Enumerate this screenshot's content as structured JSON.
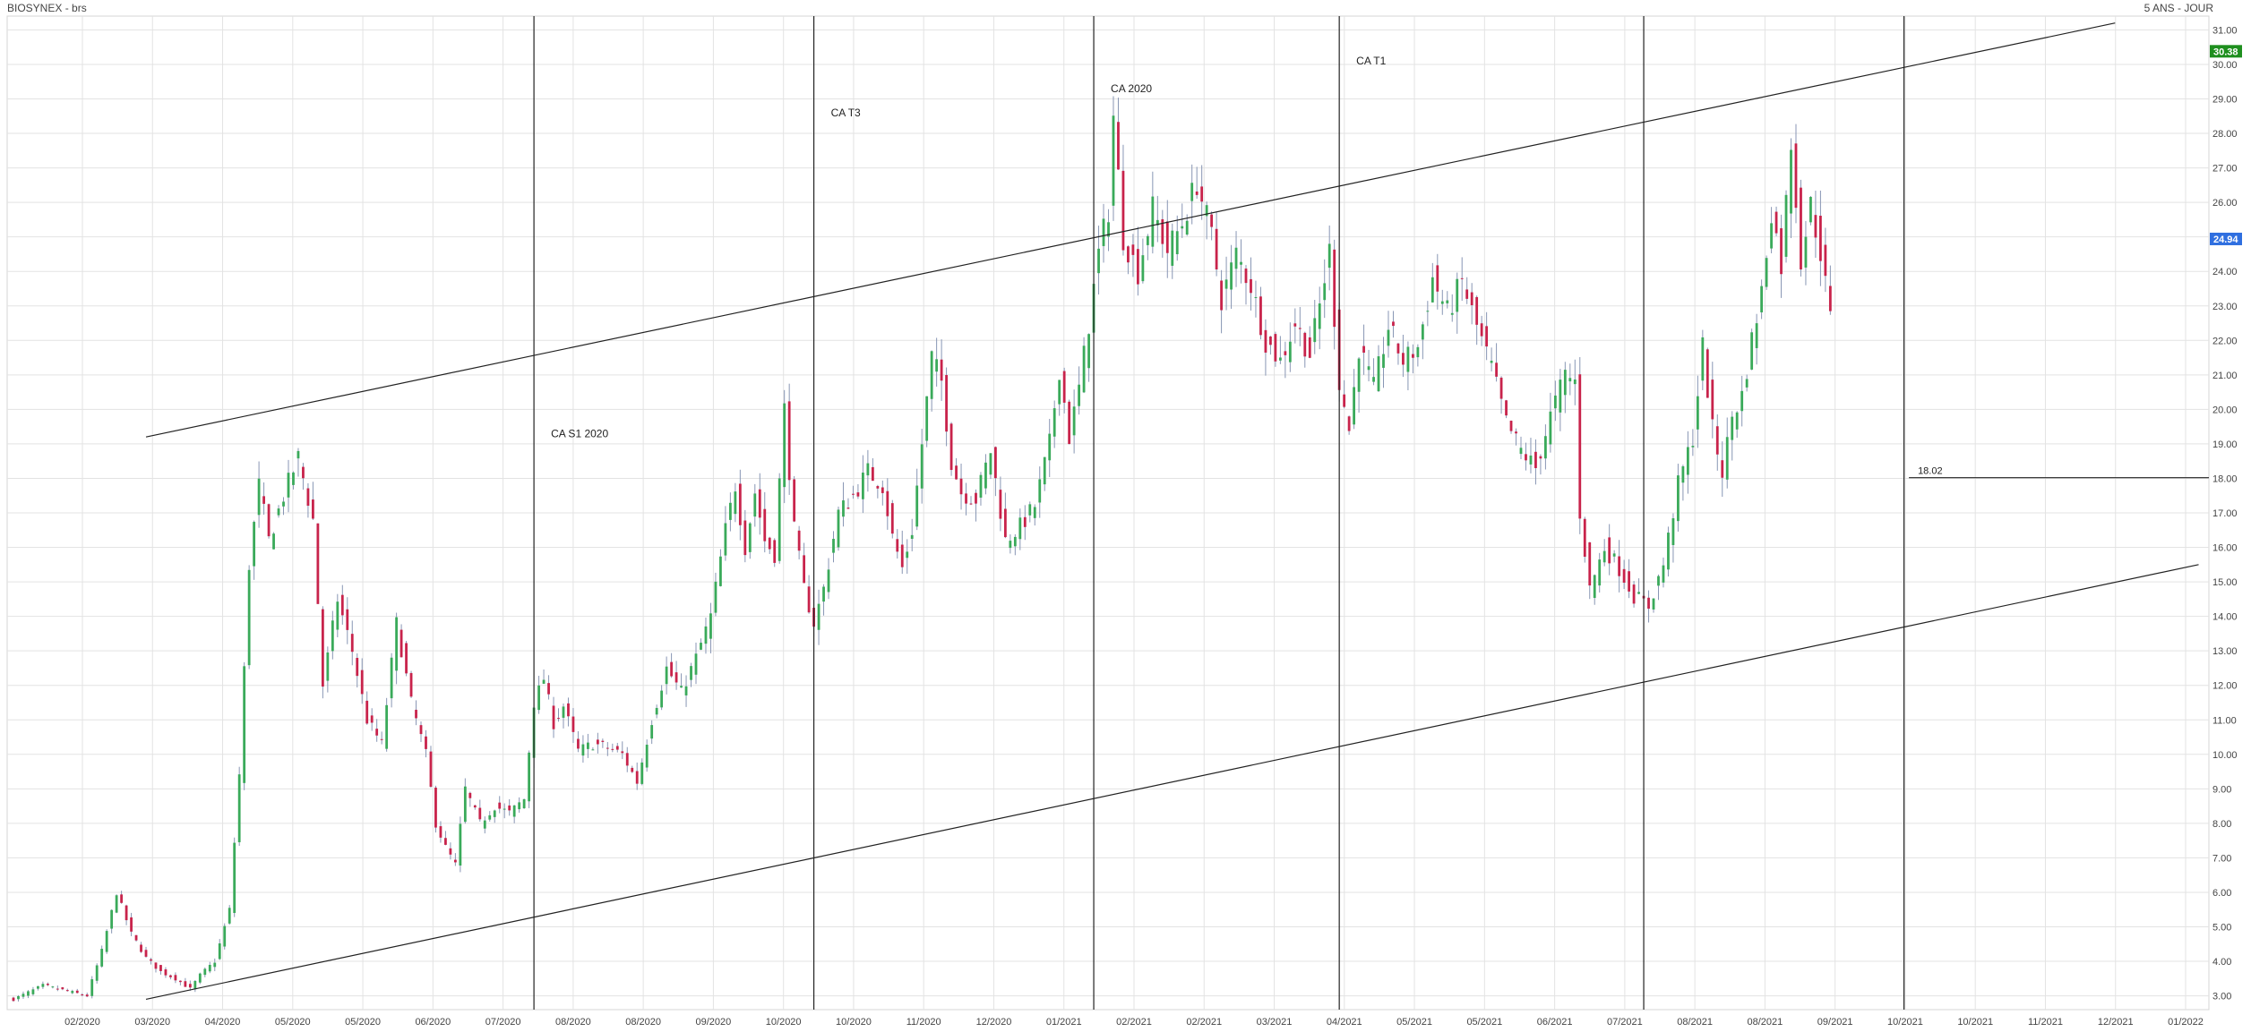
{
  "header": {
    "symbol": "BIOSYNEX - brs",
    "period": "5 ANS - JOUR"
  },
  "chart_data": {
    "type": "candlestick",
    "x_tick_labels": [
      "02/2020",
      "03/2020",
      "04/2020",
      "05/2020",
      "05/2020",
      "06/2020",
      "07/2020",
      "08/2020",
      "08/2020",
      "09/2020",
      "10/2020",
      "10/2020",
      "11/2020",
      "12/2020",
      "01/2021",
      "02/2021",
      "02/2021",
      "03/2021",
      "04/2021",
      "05/2021",
      "05/2021",
      "06/2021",
      "07/2021",
      "08/2021",
      "08/2021",
      "09/2021",
      "10/2021",
      "10/2021",
      "11/2021",
      "12/2021",
      "01/2022"
    ],
    "y_ticks": [
      3,
      4,
      5,
      6,
      7,
      8,
      9,
      10,
      11,
      12,
      13,
      14,
      15,
      16,
      17,
      18,
      19,
      20,
      21,
      22,
      23,
      24,
      25,
      26,
      27,
      28,
      29,
      30,
      31
    ],
    "y_tick_labels": [
      "3.00",
      "4.00",
      "5.00",
      "6.00",
      "7.00",
      "8.00",
      "9.00",
      "10.00",
      "11.00",
      "12.00",
      "13.00",
      "14.00",
      "15.00",
      "16.00",
      "17.00",
      "18.00",
      "19.00",
      "20.00",
      "21.00",
      "22.00",
      "23.00",
      "24.00",
      "25.00",
      "26.00",
      "27.00",
      "28.00",
      "29.00",
      "30.00",
      "31.00"
    ],
    "ylim": [
      2.6,
      31.4
    ],
    "grid": true,
    "price_badges": [
      {
        "value": 30.38,
        "label": "30.38",
        "color": "#1f8f1f"
      },
      {
        "value": 24.94,
        "label": "24.94",
        "color": "#2f6fe0"
      }
    ],
    "up_color": "#3aaa5a",
    "down_color": "#c8234b",
    "anchors": [
      {
        "i": 0,
        "c": 2.9
      },
      {
        "i": 6,
        "c": 3.3
      },
      {
        "i": 12,
        "c": 3.1
      },
      {
        "i": 15,
        "c": 3.0
      },
      {
        "i": 18,
        "c": 4.3
      },
      {
        "i": 21,
        "c": 6.0
      },
      {
        "i": 24,
        "c": 4.8
      },
      {
        "i": 27,
        "c": 4.1
      },
      {
        "i": 30,
        "c": 3.7
      },
      {
        "i": 33,
        "c": 3.5
      },
      {
        "i": 36,
        "c": 3.2
      },
      {
        "i": 38,
        "c": 3.6
      },
      {
        "i": 41,
        "c": 4.0
      },
      {
        "i": 44,
        "c": 5.5
      },
      {
        "i": 46,
        "c": 9.4
      },
      {
        "i": 48,
        "c": 15.5
      },
      {
        "i": 50,
        "c": 17.8
      },
      {
        "i": 52,
        "c": 16.2
      },
      {
        "i": 55,
        "c": 17.5
      },
      {
        "i": 58,
        "c": 18.6
      },
      {
        "i": 61,
        "c": 16.8
      },
      {
        "i": 63,
        "c": 12.0
      },
      {
        "i": 66,
        "c": 14.5
      },
      {
        "i": 69,
        "c": 13.0
      },
      {
        "i": 72,
        "c": 11.0
      },
      {
        "i": 75,
        "c": 10.3
      },
      {
        "i": 78,
        "c": 13.8
      },
      {
        "i": 81,
        "c": 11.5
      },
      {
        "i": 84,
        "c": 10.0
      },
      {
        "i": 86,
        "c": 8.0
      },
      {
        "i": 88,
        "c": 7.3
      },
      {
        "i": 90,
        "c": 6.8
      },
      {
        "i": 92,
        "c": 9.0
      },
      {
        "i": 95,
        "c": 8.0
      },
      {
        "i": 98,
        "c": 8.5
      },
      {
        "i": 101,
        "c": 8.3
      },
      {
        "i": 104,
        "c": 8.7
      },
      {
        "i": 106,
        "c": 11.5
      },
      {
        "i": 108,
        "c": 12.2
      },
      {
        "i": 110,
        "c": 10.9
      },
      {
        "i": 112,
        "c": 11.4
      },
      {
        "i": 115,
        "c": 10.1
      },
      {
        "i": 118,
        "c": 10.3
      },
      {
        "i": 121,
        "c": 10.2
      },
      {
        "i": 124,
        "c": 10.0
      },
      {
        "i": 127,
        "c": 9.2
      },
      {
        "i": 130,
        "c": 11.0
      },
      {
        "i": 133,
        "c": 12.5
      },
      {
        "i": 136,
        "c": 11.8
      },
      {
        "i": 139,
        "c": 12.8
      },
      {
        "i": 142,
        "c": 14.0
      },
      {
        "i": 145,
        "c": 16.5
      },
      {
        "i": 147,
        "c": 17.8
      },
      {
        "i": 149,
        "c": 16.0
      },
      {
        "i": 151,
        "c": 17.6
      },
      {
        "i": 153,
        "c": 16.2
      },
      {
        "i": 155,
        "c": 15.8
      },
      {
        "i": 157,
        "c": 20.0
      },
      {
        "i": 159,
        "c": 16.5
      },
      {
        "i": 161,
        "c": 14.8
      },
      {
        "i": 163,
        "c": 13.8
      },
      {
        "i": 165,
        "c": 14.8
      },
      {
        "i": 168,
        "c": 17.0
      },
      {
        "i": 171,
        "c": 17.5
      },
      {
        "i": 174,
        "c": 18.2
      },
      {
        "i": 177,
        "c": 17.8
      },
      {
        "i": 179,
        "c": 16.3
      },
      {
        "i": 181,
        "c": 15.4
      },
      {
        "i": 183,
        "c": 16.5
      },
      {
        "i": 185,
        "c": 19.0
      },
      {
        "i": 187,
        "c": 21.5
      },
      {
        "i": 189,
        "c": 20.8
      },
      {
        "i": 191,
        "c": 18.5
      },
      {
        "i": 193,
        "c": 17.6
      },
      {
        "i": 196,
        "c": 17.4
      },
      {
        "i": 199,
        "c": 18.8
      },
      {
        "i": 202,
        "c": 16.2
      },
      {
        "i": 205,
        "c": 16.6
      },
      {
        "i": 208,
        "c": 17.2
      },
      {
        "i": 211,
        "c": 19.0
      },
      {
        "i": 213,
        "c": 21.2
      },
      {
        "i": 215,
        "c": 19.2
      },
      {
        "i": 217,
        "c": 20.6
      },
      {
        "i": 219,
        "c": 22.5
      },
      {
        "i": 221,
        "c": 24.5
      },
      {
        "i": 223,
        "c": 25.8
      },
      {
        "i": 224,
        "c": 28.5
      },
      {
        "i": 226,
        "c": 25.0
      },
      {
        "i": 229,
        "c": 24.0
      },
      {
        "i": 232,
        "c": 25.8
      },
      {
        "i": 235,
        "c": 24.6
      },
      {
        "i": 238,
        "c": 25.4
      },
      {
        "i": 241,
        "c": 26.6
      },
      {
        "i": 244,
        "c": 25.0
      },
      {
        "i": 246,
        "c": 23.2
      },
      {
        "i": 249,
        "c": 24.5
      },
      {
        "i": 252,
        "c": 23.6
      },
      {
        "i": 255,
        "c": 22.0
      },
      {
        "i": 258,
        "c": 21.4
      },
      {
        "i": 261,
        "c": 22.5
      },
      {
        "i": 264,
        "c": 21.6
      },
      {
        "i": 266,
        "c": 23.0
      },
      {
        "i": 268,
        "c": 24.6
      },
      {
        "i": 270,
        "c": 20.8
      },
      {
        "i": 272,
        "c": 19.4
      },
      {
        "i": 274,
        "c": 21.8
      },
      {
        "i": 277,
        "c": 20.6
      },
      {
        "i": 280,
        "c": 22.4
      },
      {
        "i": 283,
        "c": 21.4
      },
      {
        "i": 286,
        "c": 21.8
      },
      {
        "i": 289,
        "c": 23.8
      },
      {
        "i": 292,
        "c": 22.8
      },
      {
        "i": 295,
        "c": 23.7
      },
      {
        "i": 298,
        "c": 22.4
      },
      {
        "i": 301,
        "c": 21.2
      },
      {
        "i": 304,
        "c": 19.6
      },
      {
        "i": 307,
        "c": 18.8
      },
      {
        "i": 310,
        "c": 18.3
      },
      {
        "i": 313,
        "c": 19.8
      },
      {
        "i": 316,
        "c": 21.0
      },
      {
        "i": 318,
        "c": 20.8
      },
      {
        "i": 319,
        "c": 17.0
      },
      {
        "i": 321,
        "c": 14.8
      },
      {
        "i": 324,
        "c": 16.0
      },
      {
        "i": 327,
        "c": 15.4
      },
      {
        "i": 330,
        "c": 14.6
      },
      {
        "i": 333,
        "c": 14.3
      },
      {
        "i": 336,
        "c": 15.5
      },
      {
        "i": 339,
        "c": 17.8
      },
      {
        "i": 342,
        "c": 19.2
      },
      {
        "i": 344,
        "c": 21.8
      },
      {
        "i": 346,
        "c": 19.4
      },
      {
        "i": 348,
        "c": 18.2
      },
      {
        "i": 350,
        "c": 19.8
      },
      {
        "i": 352,
        "c": 20.4
      },
      {
        "i": 354,
        "c": 22.0
      },
      {
        "i": 356,
        "c": 23.4
      },
      {
        "i": 358,
        "c": 25.8
      },
      {
        "i": 360,
        "c": 24.2
      },
      {
        "i": 362,
        "c": 27.8
      },
      {
        "i": 364,
        "c": 24.4
      },
      {
        "i": 366,
        "c": 25.9
      },
      {
        "i": 368,
        "c": 24.6
      },
      {
        "i": 370,
        "c": 22.6
      }
    ],
    "vertical_markers": [
      {
        "label": "CA S1 2020",
        "index": 106,
        "label_value": 19.3
      },
      {
        "label": "CA T3",
        "index": 163,
        "label_value": 28.6
      },
      {
        "label": "CA 2020",
        "index": 220,
        "label_value": 29.3
      },
      {
        "label": "CA T1",
        "index": 270,
        "label_value": 30.1
      },
      {
        "label": "",
        "index": 332
      },
      {
        "label": "",
        "index": 385
      }
    ],
    "trend_lines": [
      {
        "from": {
          "index": 27,
          "value": 19.2
        },
        "to": {
          "index": 428,
          "value": 31.2
        }
      },
      {
        "from": {
          "index": 27,
          "value": 2.9
        },
        "to": {
          "index": 445,
          "value": 15.5
        }
      }
    ],
    "horizontal_lines": [
      {
        "value": 18.02,
        "label": "18.02",
        "from_index": 386
      }
    ]
  }
}
